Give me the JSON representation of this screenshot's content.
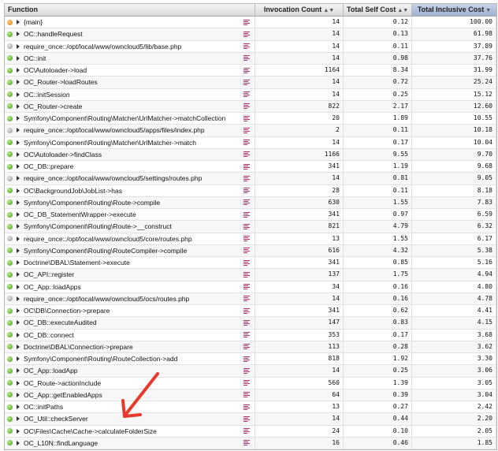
{
  "columns": {
    "function": "Function",
    "invocation_count": "Invocation Count",
    "total_self_cost": "Total Self Cost",
    "total_inclusive_cost": "Total Inclusive Cost"
  },
  "sorted_column": "total_inclusive_cost",
  "colors": {
    "header_sorted": "#9fb2d1",
    "flag": "#b5316a",
    "annotation_arrow": "#e8392e"
  },
  "rows": [
    {
      "status": "orange",
      "name": "{main}",
      "count": "14",
      "self": "0.12",
      "incl": "100.00"
    },
    {
      "status": "green",
      "name": "OC::handleRequest",
      "count": "14",
      "self": "0.13",
      "incl": "61.98"
    },
    {
      "status": "gray",
      "name": "require_once::/opt/local/www/owncloud5/lib/base.php",
      "count": "14",
      "self": "0.11",
      "incl": "37.89"
    },
    {
      "status": "green",
      "name": "OC::init",
      "count": "14",
      "self": "0.98",
      "incl": "37.76"
    },
    {
      "status": "green",
      "name": "OC\\Autoloader->load",
      "count": "1164",
      "self": "8.34",
      "incl": "31.99"
    },
    {
      "status": "green",
      "name": "OC_Router->loadRoutes",
      "count": "14",
      "self": "0.72",
      "incl": "25.24"
    },
    {
      "status": "green",
      "name": "OC::initSession",
      "count": "14",
      "self": "0.25",
      "incl": "15.12"
    },
    {
      "status": "green",
      "name": "OC_Router->create",
      "count": "822",
      "self": "2.17",
      "incl": "12.60"
    },
    {
      "status": "green",
      "name": "Symfony\\Component\\Routing\\Matcher\\UrlMatcher->matchCollection",
      "count": "20",
      "self": "1.89",
      "incl": "10.55"
    },
    {
      "status": "gray",
      "name": "require_once::/opt/local/www/owncloud5/apps/files/index.php",
      "count": "2",
      "self": "0.11",
      "incl": "10.18"
    },
    {
      "status": "green",
      "name": "Symfony\\Component\\Routing\\Matcher\\UrlMatcher->match",
      "count": "14",
      "self": "0.17",
      "incl": "10.04"
    },
    {
      "status": "green",
      "name": "OC\\Autoloader->findClass",
      "count": "1166",
      "self": "9.55",
      "incl": "9.70"
    },
    {
      "status": "green",
      "name": "OC_DB::prepare",
      "count": "341",
      "self": "1.19",
      "incl": "9.68"
    },
    {
      "status": "gray",
      "name": "require_once::/opt/local/www/owncloud5/settings/routes.php",
      "count": "14",
      "self": "0.81",
      "incl": "9.05"
    },
    {
      "status": "green",
      "name": "OC\\BackgroundJob\\JobList->has",
      "count": "28",
      "self": "0.11",
      "incl": "8.18"
    },
    {
      "status": "green",
      "name": "Symfony\\Component\\Routing\\Route->compile",
      "count": "630",
      "self": "1.55",
      "incl": "7.83"
    },
    {
      "status": "green",
      "name": "OC_DB_StatementWrapper->execute",
      "count": "341",
      "self": "0.97",
      "incl": "6.59"
    },
    {
      "status": "green",
      "name": "Symfony\\Component\\Routing\\Route->__construct",
      "count": "821",
      "self": "4.79",
      "incl": "6.32"
    },
    {
      "status": "gray",
      "name": "require_once::/opt/local/www/owncloud5/core/routes.php",
      "count": "13",
      "self": "1.55",
      "incl": "6.17"
    },
    {
      "status": "green",
      "name": "Symfony\\Component\\Routing\\RouteCompiler->compile",
      "count": "616",
      "self": "4.32",
      "incl": "5.38"
    },
    {
      "status": "green",
      "name": "Doctrine\\DBAL\\Statement->execute",
      "count": "341",
      "self": "0.85",
      "incl": "5.16"
    },
    {
      "status": "green",
      "name": "OC_API::register",
      "count": "137",
      "self": "1.75",
      "incl": "4.94"
    },
    {
      "status": "green",
      "name": "OC_App::loadApps",
      "count": "34",
      "self": "0.16",
      "incl": "4.80"
    },
    {
      "status": "gray",
      "name": "require_once::/opt/local/www/owncloud5/ocs/routes.php",
      "count": "14",
      "self": "0.16",
      "incl": "4.78"
    },
    {
      "status": "green",
      "name": "OC\\DB\\Connection->prepare",
      "count": "341",
      "self": "0.62",
      "incl": "4.41"
    },
    {
      "status": "green",
      "name": "OC_DB::executeAudited",
      "count": "147",
      "self": "0.83",
      "incl": "4.15"
    },
    {
      "status": "green",
      "name": "OC_DB::connect",
      "count": "353",
      "self": "0.17",
      "incl": "3.68"
    },
    {
      "status": "green",
      "name": "Doctrine\\DBAL\\Connection->prepare",
      "count": "113",
      "self": "0.28",
      "incl": "3.62"
    },
    {
      "status": "green",
      "name": "Symfony\\Component\\Routing\\RouteCollection->add",
      "count": "818",
      "self": "1.92",
      "incl": "3.30"
    },
    {
      "status": "green",
      "name": "OC_App::loadApp",
      "count": "14",
      "self": "0.25",
      "incl": "3.06"
    },
    {
      "status": "green",
      "name": "OC_Route->actionInclude",
      "count": "560",
      "self": "1.39",
      "incl": "3.05"
    },
    {
      "status": "green",
      "name": "OC_App::getEnabledApps",
      "count": "64",
      "self": "0.39",
      "incl": "3.04"
    },
    {
      "status": "green",
      "name": "OC::initPaths",
      "count": "13",
      "self": "0.27",
      "incl": "2.42"
    },
    {
      "status": "green",
      "name": "OC_Util::checkServer",
      "count": "14",
      "self": "0.44",
      "incl": "2.20"
    },
    {
      "status": "green",
      "name": "OC\\Files\\Cache\\Cache->calculateFolderSize",
      "count": "24",
      "self": "0.10",
      "incl": "2.05"
    },
    {
      "status": "green",
      "name": "OC_L10N::findLanguage",
      "count": "16",
      "self": "0.46",
      "incl": "1.85"
    }
  ]
}
